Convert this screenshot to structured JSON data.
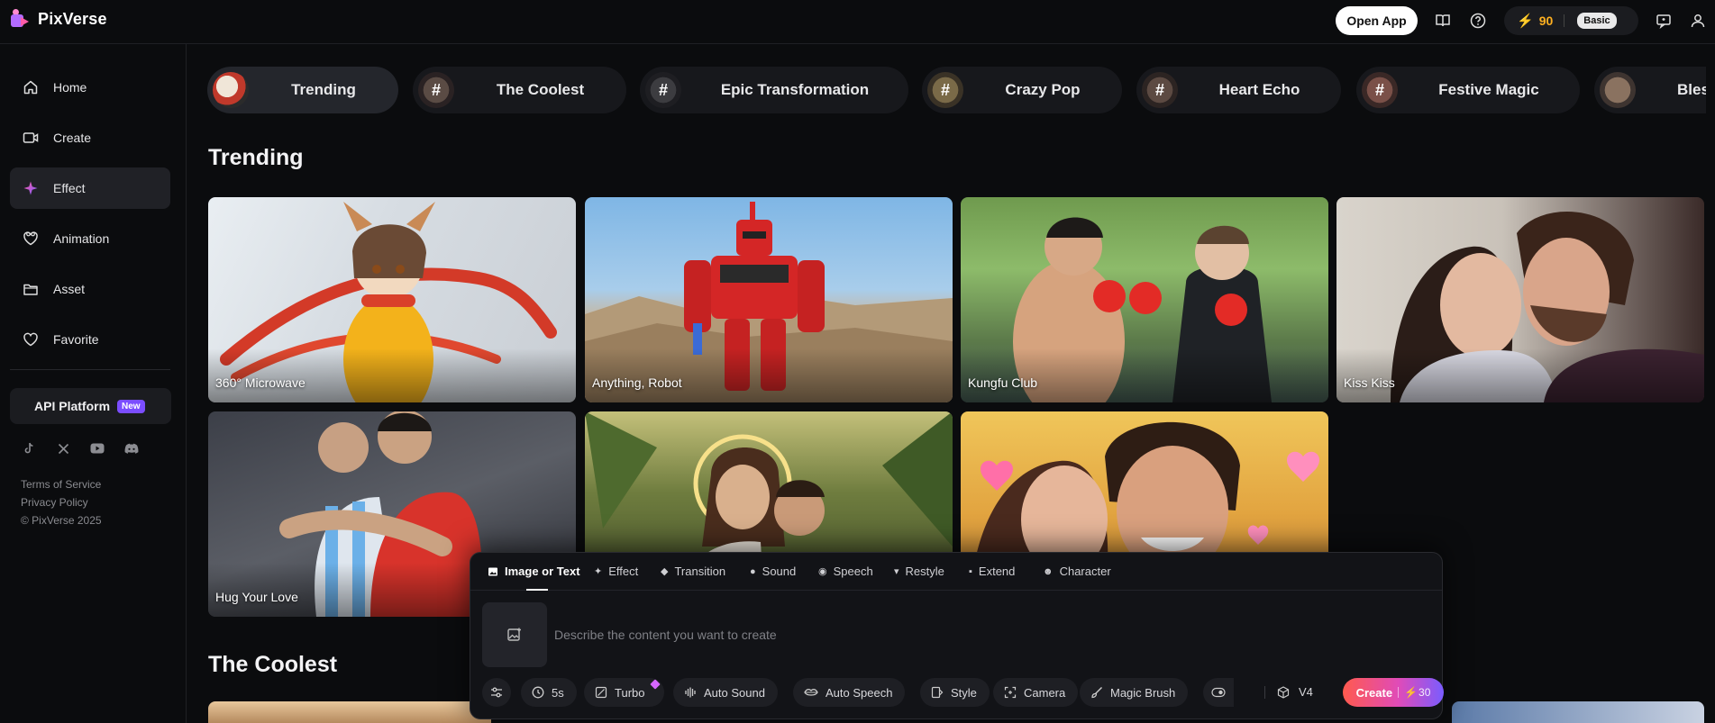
{
  "app": {
    "name": "PixVerse"
  },
  "header": {
    "open_app": "Open App",
    "credits": "90",
    "plan": "Basic",
    "icons": [
      "book-icon",
      "help-icon",
      "feedback-icon",
      "user-icon"
    ]
  },
  "sidebar": {
    "items": [
      {
        "label": "Home",
        "icon": "home-icon"
      },
      {
        "label": "Create",
        "icon": "video-camera-icon"
      },
      {
        "label": "Effect",
        "icon": "sparkle-icon"
      },
      {
        "label": "Animation",
        "icon": "heart-outline-icon"
      },
      {
        "label": "Asset",
        "icon": "folder-icon"
      },
      {
        "label": "Favorite",
        "icon": "heart-icon"
      }
    ],
    "active": "Effect",
    "api": {
      "label": "API Platform",
      "badge": "New"
    },
    "socials": [
      "tiktok-icon",
      "x-icon",
      "youtube-icon",
      "discord-icon"
    ],
    "legal": [
      "Terms of Service",
      "Privacy Policy",
      "© PixVerse 2025"
    ]
  },
  "categories": [
    "Trending",
    "The Coolest",
    "Epic Transformation",
    "Crazy Pop",
    "Heart Echo",
    "Festive Magic",
    "Bles"
  ],
  "sections": {
    "trending": "Trending",
    "coolest": "The Coolest"
  },
  "cards": [
    "360° Microwave",
    "Anything, Robot",
    "Kungfu Club",
    "Kiss Kiss",
    "Hug Your Love",
    "",
    ""
  ],
  "composer": {
    "tabs": [
      "Image or Text",
      "Effect",
      "Transition",
      "Sound",
      "Speech",
      "Restyle",
      "Extend",
      "Character"
    ],
    "placeholder": "Describe the content you want to create",
    "tools": [
      "5s",
      "Turbo",
      "Auto Sound",
      "Auto Speech",
      "Style",
      "Camera",
      "Magic Brush"
    ],
    "version": "V4",
    "create": "Create",
    "cost": "30"
  },
  "colors": {
    "accent_gold": "#ffb020",
    "badge_purple": "#7b4dff",
    "create_gradient": [
      "#ff5a4e",
      "#e04bb8",
      "#7a5cff"
    ]
  }
}
